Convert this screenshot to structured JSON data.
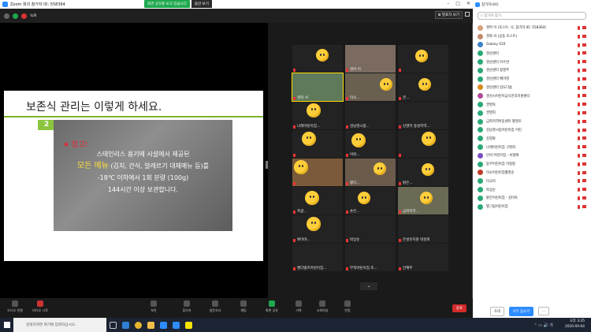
{
  "window": {
    "title": "Zoom 회의 참가자 ID: 558364",
    "share_status": "화면 공유를 보고 있습니다",
    "view_options": "옵션 보기"
  },
  "meeting": {
    "recording_label": "녹화",
    "view_button": "⊞ 발표자 보기"
  },
  "slide": {
    "title": "보존식 관리는 이렇게 하세요.",
    "number": "2",
    "star": "★ 참고!",
    "line1": "스테인리스 용기에  시설에서 제공된",
    "line2_highlight": "모든 메뉴",
    "line2_rest": " (김치, 간식, 알레르기 대체메뉴 등)를",
    "line3": "-18℃ 이하에서 1회 분량 (100g)",
    "line4": "144시간 이상 보관합니다."
  },
  "gallery": [
    {
      "name": ""
    },
    {
      "name": "경아 이"
    },
    {
      "name": ""
    },
    {
      "name": "경화 서"
    },
    {
      "name": "미소..."
    },
    {
      "name": "큰..."
    },
    {
      "name": "나래어린이집..."
    },
    {
      "name": "김남경시립..."
    },
    {
      "name": "신영미 용성지역..."
    },
    {
      "name": ""
    },
    {
      "name": "어린..."
    },
    {
      "name": ""
    },
    {
      "name": ""
    },
    {
      "name": "황다..."
    },
    {
      "name": "밝은..."
    },
    {
      "name": "흑광..."
    },
    {
      "name": "손은..."
    },
    {
      "name": "금파지역..."
    },
    {
      "name": "뽀미야..."
    },
    {
      "name": "박상순"
    },
    {
      "name": "은성유치원 박성희"
    },
    {
      "name": "밴다빌즈어린이집..."
    },
    {
      "name": "부적어린이집 조..."
    },
    {
      "name": "안혜주"
    }
  ],
  "toolbar": {
    "audio": "오디오 연결",
    "video": "비디오 시작",
    "security": "보안",
    "participants": "참가자",
    "participants_count": "40",
    "polls": "설문조사",
    "chat": "채팅",
    "share": "화면 공유",
    "record": "기록",
    "breakout": "소회의실",
    "reactions": "반응",
    "end": "종료"
  },
  "panel": {
    "title": "참가자(40)",
    "search_placeholder": "참가자 찾기",
    "items": [
      {
        "name": "경아 이 (호스트, 나, 참가자 ID: 558364)",
        "color": "#d9a07b"
      },
      {
        "name": "경화 서 (공동 호스트)",
        "color": "#c48a6b"
      },
      {
        "name": "Galaxy S10",
        "color": "#3b7fc4"
      },
      {
        "name": "경산센터",
        "color": "#2aa876"
      },
      {
        "name": "경산센터 이수연",
        "color": "#2aa876"
      },
      {
        "name": "경산센터 정영주",
        "color": "#2aa876"
      },
      {
        "name": "경산센터 배미영",
        "color": "#2aa876"
      },
      {
        "name": "경산센터 김도다솜",
        "color": "#d88a1f"
      },
      {
        "name": "경산시어린이급식관리지원센터",
        "color": "#b04a98"
      },
      {
        "name": "권영숙",
        "color": "#2aa876"
      },
      {
        "name": "권영희",
        "color": "#2aa876"
      },
      {
        "name": "금파지역아동센터 황명조",
        "color": "#2aa876"
      },
      {
        "name": "김남경시립어린이집 어린",
        "color": "#2aa876"
      },
      {
        "name": "김영화",
        "color": "#2aa876"
      },
      {
        "name": "나래어린이집 구명회",
        "color": "#2aa876"
      },
      {
        "name": "단비 어린이집 - 서정애",
        "color": "#7a4fc4"
      },
      {
        "name": "동부어린이집 이정랑",
        "color": "#2aa876"
      },
      {
        "name": "미소어린이집황명순",
        "color": "#c0392b"
      },
      {
        "name": "미교리",
        "color": "#2aa876"
      },
      {
        "name": "박상순",
        "color": "#2aa876"
      },
      {
        "name": "밝은어린이집 - 김미숙",
        "color": "#2aa876"
      },
      {
        "name": "별그림어린이집",
        "color": "#2aa876"
      }
    ],
    "invite": "초대",
    "mute_all": "모두 음소거",
    "more": "..."
  },
  "taskbar": {
    "search_placeholder": "검색하려면 여기에 입력하십시오.",
    "time": "오후 3:35",
    "date": "2020-09-04"
  }
}
